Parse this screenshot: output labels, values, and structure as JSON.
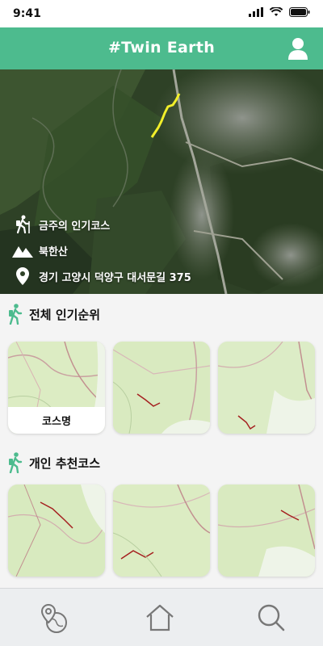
{
  "status_bar": {
    "time": "9:41"
  },
  "header": {
    "title": "#Twin Earth"
  },
  "hero": {
    "popular_label": "금주의 인기코스",
    "mountain_name": "북한산",
    "address": "경기 고양시 덕양구 대서문길 375"
  },
  "sections": {
    "overall_ranking": {
      "title": "전체 인기순위",
      "cards": [
        {
          "caption": "코스명"
        },
        {
          "caption": ""
        },
        {
          "caption": ""
        }
      ]
    },
    "personal_recommend": {
      "title": "개인 추천코스"
    }
  },
  "colors": {
    "accent": "#4dbb8e",
    "trail": "#f2ef2a"
  },
  "icons": {
    "profile": "user-icon",
    "hiker": "hiker-icon",
    "mountain": "mountain-icon",
    "location": "location-pin-icon",
    "nav": [
      "map-location-icon",
      "home-icon",
      "search-icon"
    ]
  }
}
